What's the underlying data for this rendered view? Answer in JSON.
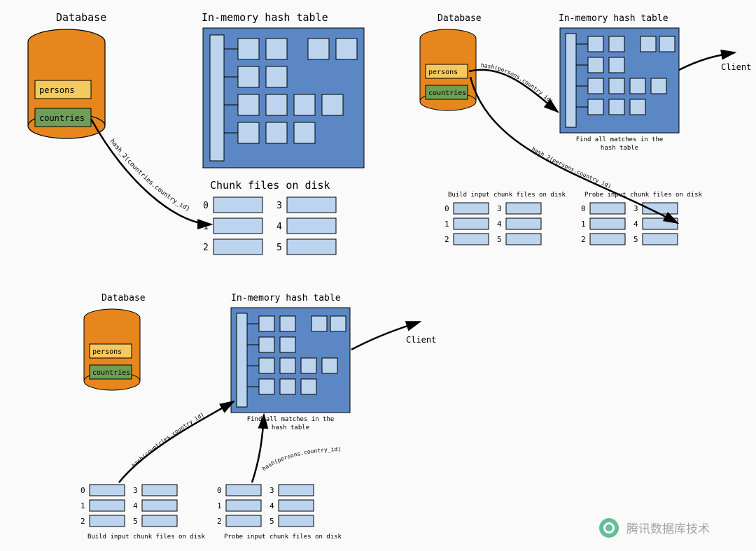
{
  "watermark": "腾讯数据库技术",
  "panels": {
    "top_left": {
      "db_title": "Database",
      "persons_label": "persons",
      "countries_label": "countries",
      "hash_title": "In-memory hash table",
      "arrow_label": "hash_2(countries.country_id)",
      "chunk_title": "Chunk files on disk",
      "chunk_numbers_left": [
        "0",
        "1",
        "2"
      ],
      "chunk_numbers_right": [
        "3",
        "4",
        "5"
      ]
    },
    "top_right": {
      "db_title": "Database",
      "persons_label": "persons",
      "countries_label": "countries",
      "hash_title": "In-memory hash table",
      "hash_subtitle": "Find all matches in the\nhash table",
      "client_label": "Client",
      "arrow_label_hash": "hash(persons.country_id)",
      "arrow_label_hash2": "hash_2(persons.country_id)",
      "build_chunk_title": "Build input chunk files on disk",
      "probe_chunk_title": "Probe input chunk files on disk",
      "chunk_numbers_left": [
        "0",
        "1",
        "2"
      ],
      "chunk_numbers_right": [
        "3",
        "4",
        "5"
      ]
    },
    "bottom": {
      "db_title": "Database",
      "persons_label": "persons",
      "countries_label": "countries",
      "hash_title": "In-memory hash table",
      "hash_subtitle": "Find all matches in the\nhash table",
      "client_label": "Client",
      "arrow_label_build": "hash(countries.country_id)",
      "arrow_label_probe": "hash(persons.country_id)",
      "build_chunk_title": "Build input chunk files on disk",
      "probe_chunk_title": "Probe input chunk files on disk",
      "chunk_numbers_left": [
        "0",
        "1",
        "2"
      ],
      "chunk_numbers_right": [
        "3",
        "4",
        "5"
      ]
    }
  }
}
